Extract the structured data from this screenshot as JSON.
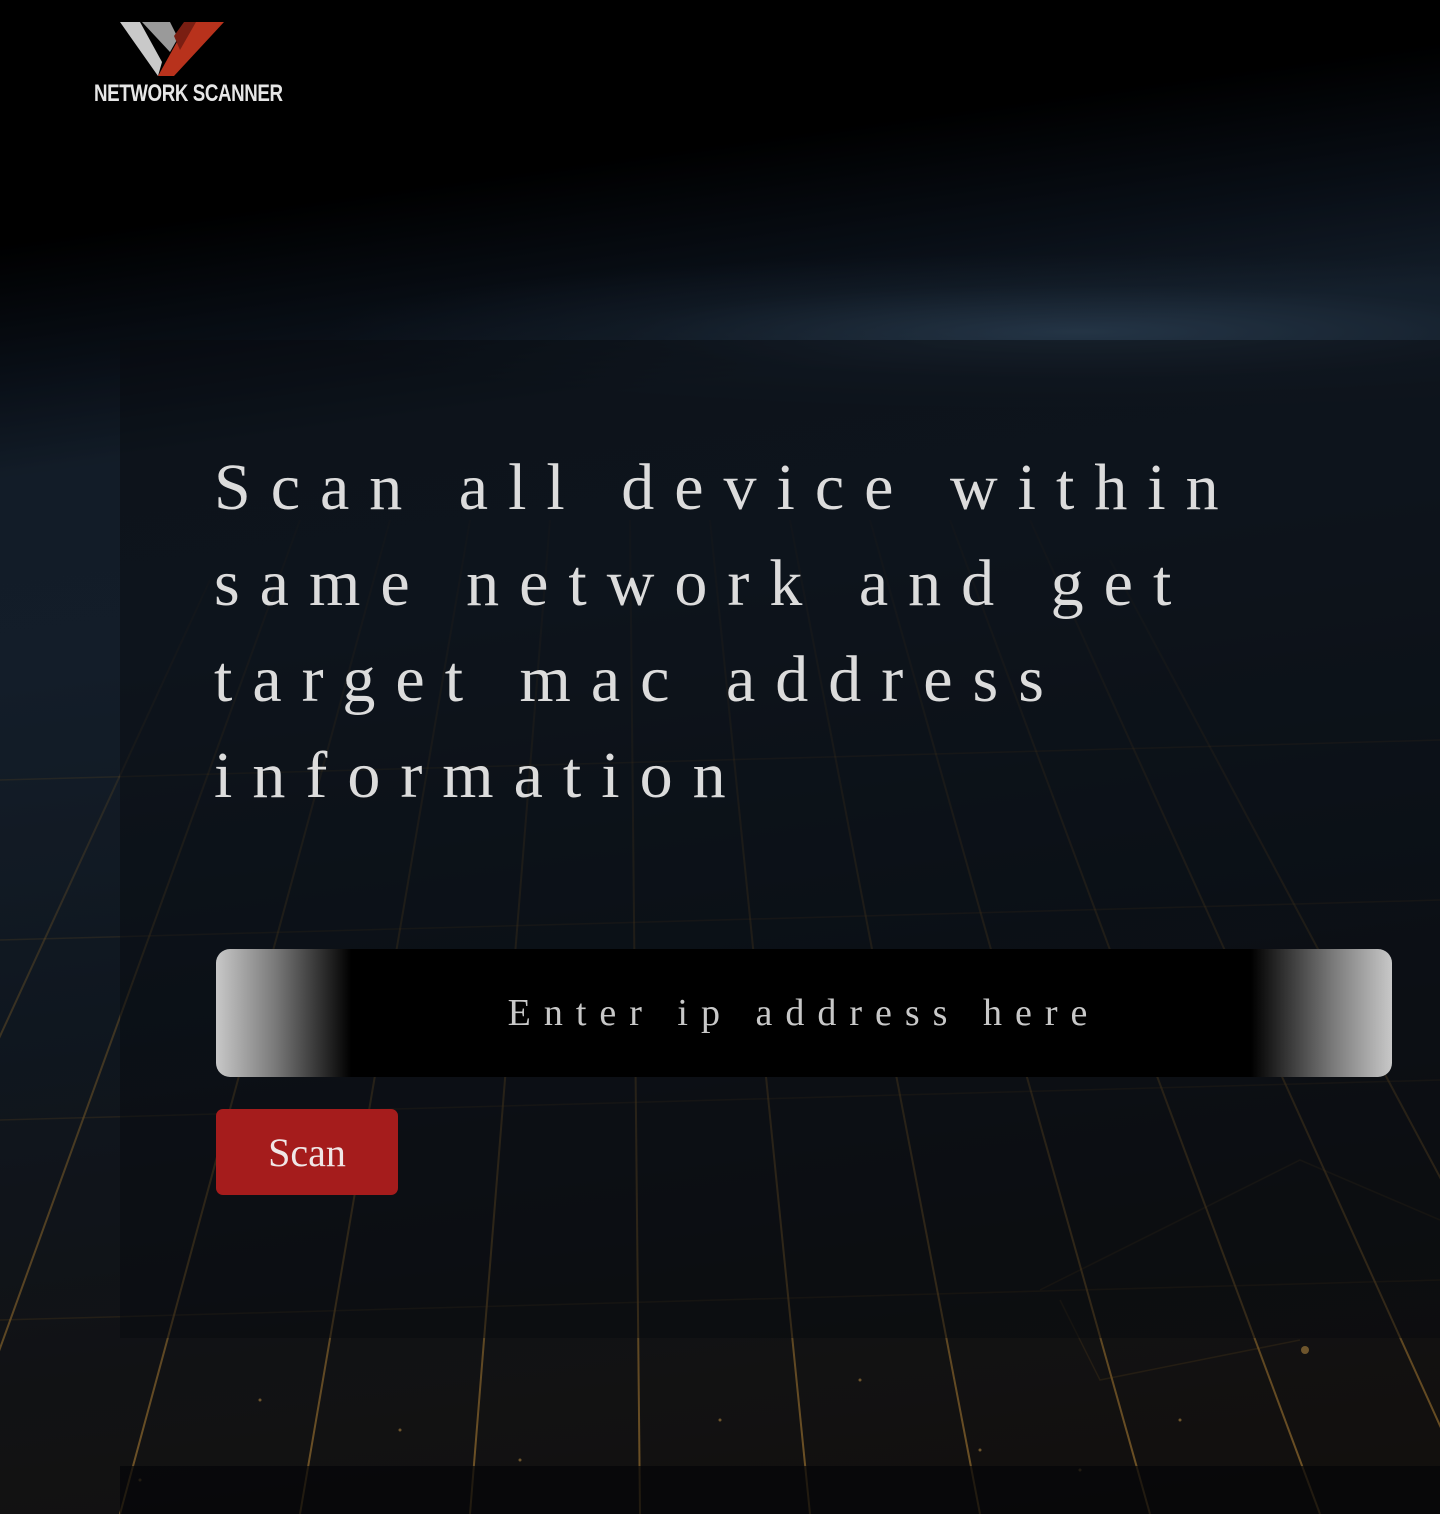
{
  "brand": {
    "logo_icon": "network-scanner-w-logo",
    "name": "NETWORK SCANNER"
  },
  "hero": {
    "headline": "Scan all device within same network and get target mac address information"
  },
  "scan_form": {
    "ip_placeholder": "Enter ip address here",
    "ip_value": "",
    "scan_label": "Scan"
  },
  "colors": {
    "accent_red": "#a51c1c",
    "logo_red": "#b8321c",
    "logo_silver": "#c9c9c9",
    "text_light": "#dcdcdc"
  }
}
